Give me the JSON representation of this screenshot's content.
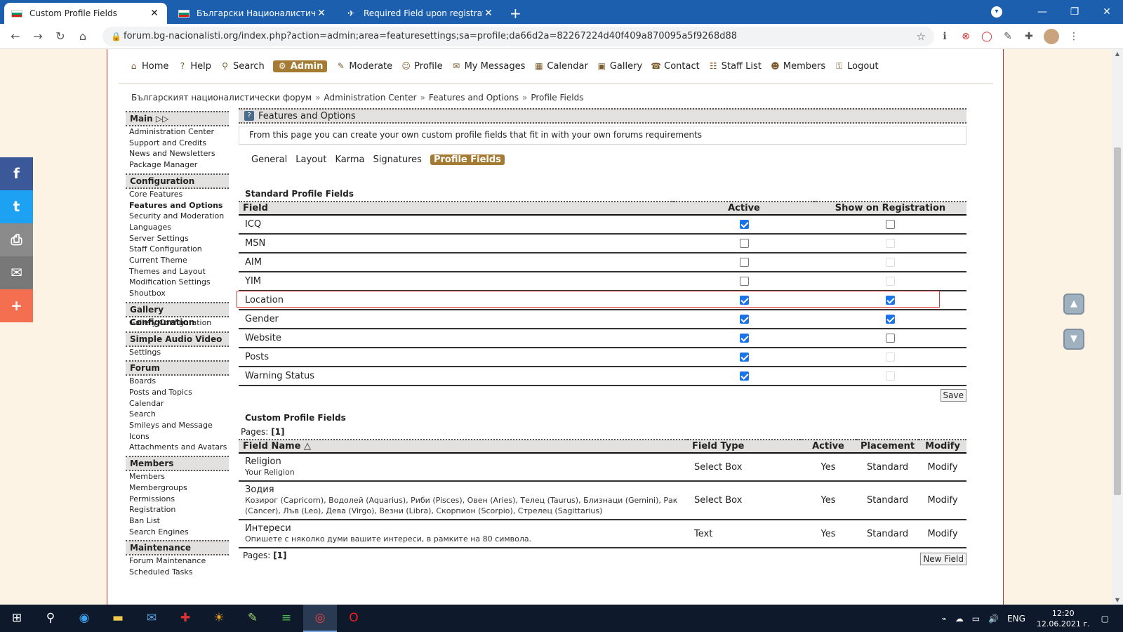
{
  "browser": {
    "tabs": [
      {
        "title": "Custom Profile Fields",
        "active": true
      },
      {
        "title": "Български Националистически",
        "active": false
      },
      {
        "title": "Required Field upon registration",
        "active": false
      }
    ],
    "url": "forum.bg-nacionalisti.org/index.php?action=admin;area=featuresettings;sa=profile;da66d2a=82267224d40f409a870095a5f9268d88"
  },
  "menu": [
    {
      "label": "Home",
      "icon": "home-icon"
    },
    {
      "label": "Help",
      "icon": "help-icon"
    },
    {
      "label": "Search",
      "icon": "search-icon"
    },
    {
      "label": "Admin",
      "icon": "gear-icon",
      "active": true
    },
    {
      "label": "Moderate",
      "icon": "wrench-icon"
    },
    {
      "label": "Profile",
      "icon": "user-icon"
    },
    {
      "label": "My Messages",
      "icon": "envelope-icon"
    },
    {
      "label": "Calendar",
      "icon": "calendar-icon"
    },
    {
      "label": "Gallery",
      "icon": "image-icon"
    },
    {
      "label": "Contact",
      "icon": "contact-icon"
    },
    {
      "label": "Staff List",
      "icon": "staff-icon"
    },
    {
      "label": "Members",
      "icon": "members-icon"
    },
    {
      "label": "Logout",
      "icon": "key-icon"
    }
  ],
  "breadcrumb": [
    "Българският националистически форум",
    "Administration Center",
    "Features and Options",
    "Profile Fields"
  ],
  "sidebar": {
    "sections": [
      {
        "title": "Main ▷▷",
        "items": [
          "Administration Center",
          "Support and Credits",
          "News and Newsletters",
          "Package Manager"
        ]
      },
      {
        "title": "Configuration",
        "items": [
          "Core Features",
          "Features and Options",
          "Security and Moderation",
          "Languages",
          "Server Settings",
          "Staff Configuration",
          "Current Theme",
          "Themes and Layout",
          "Modification Settings",
          "Shoutbox"
        ]
      },
      {
        "title": "Gallery Configuration",
        "items": [
          "Gallery Configuration"
        ]
      },
      {
        "title": "Simple Audio Video",
        "items": [
          "Settings"
        ]
      },
      {
        "title": "Forum",
        "items": [
          "Boards",
          "Posts and Topics",
          "Calendar",
          "Search",
          "Smileys and Message",
          "Icons",
          "Attachments and Avatars"
        ]
      },
      {
        "title": "Members",
        "items": [
          "Members",
          "Membergroups",
          "Permissions",
          "Registration",
          "Ban List",
          "Search Engines"
        ]
      },
      {
        "title": "Maintenance",
        "items": [
          "Forum Maintenance",
          "Scheduled Tasks"
        ]
      }
    ],
    "current": "Features and Options"
  },
  "content": {
    "title": "Features and Options",
    "description": "From this page you can create your own custom profile fields that fit in with your own forums requirements",
    "subtabs": [
      "General",
      "Layout",
      "Karma",
      "Signatures",
      "Profile Fields"
    ],
    "active_subtab": "Profile Fields",
    "standard": {
      "title": "Standard Profile Fields",
      "headers": [
        "Field",
        "Active",
        "Show on Registration"
      ],
      "rows": [
        {
          "name": "ICQ",
          "active": true,
          "reg": "off"
        },
        {
          "name": "MSN",
          "active": false,
          "reg": "disabled"
        },
        {
          "name": "AIM",
          "active": false,
          "reg": "disabled"
        },
        {
          "name": "YIM",
          "active": false,
          "reg": "disabled"
        },
        {
          "name": "Location",
          "active": true,
          "reg": "on",
          "highlight": true
        },
        {
          "name": "Gender",
          "active": true,
          "reg": "on"
        },
        {
          "name": "Website",
          "active": true,
          "reg": "off"
        },
        {
          "name": "Posts",
          "active": true,
          "reg": "disabled"
        },
        {
          "name": "Warning Status",
          "active": true,
          "reg": "disabled"
        }
      ],
      "save_label": "Save"
    },
    "custom": {
      "title": "Custom Profile Fields",
      "pages_label": "Pages:",
      "pages_value": "[1]",
      "headers": [
        "Field Name",
        "Field Type",
        "Active",
        "Placement",
        "Modify"
      ],
      "rows": [
        {
          "name": "Religion",
          "desc": "Your Religion",
          "type": "Select Box",
          "active": "Yes",
          "placement": "Standard",
          "modify": "Modify"
        },
        {
          "name": "Зодия",
          "desc": "Козирог (Capricorn), Водолей (Aquarius), Риби (Pisces), Овен (Aries), Телец (Taurus), Близнаци (Gemini), Рак (Cancer), Лъв (Leo), Дева (Virgo), Везни (Libra), Скорпион (Scorpio), Стрелец (Sagittarius)",
          "type": "Select Box",
          "active": "Yes",
          "placement": "Standard",
          "modify": "Modify"
        },
        {
          "name": "Интереси",
          "desc": "Опишете с няколко думи вашите интереси, в рамките на 80 символа.",
          "type": "Text",
          "active": "Yes",
          "placement": "Standard",
          "modify": "Modify"
        }
      ],
      "new_field_label": "New Field"
    }
  },
  "taskbar": {
    "lang": "ENG",
    "time": "12:20",
    "date": "12.06.2021 г."
  }
}
